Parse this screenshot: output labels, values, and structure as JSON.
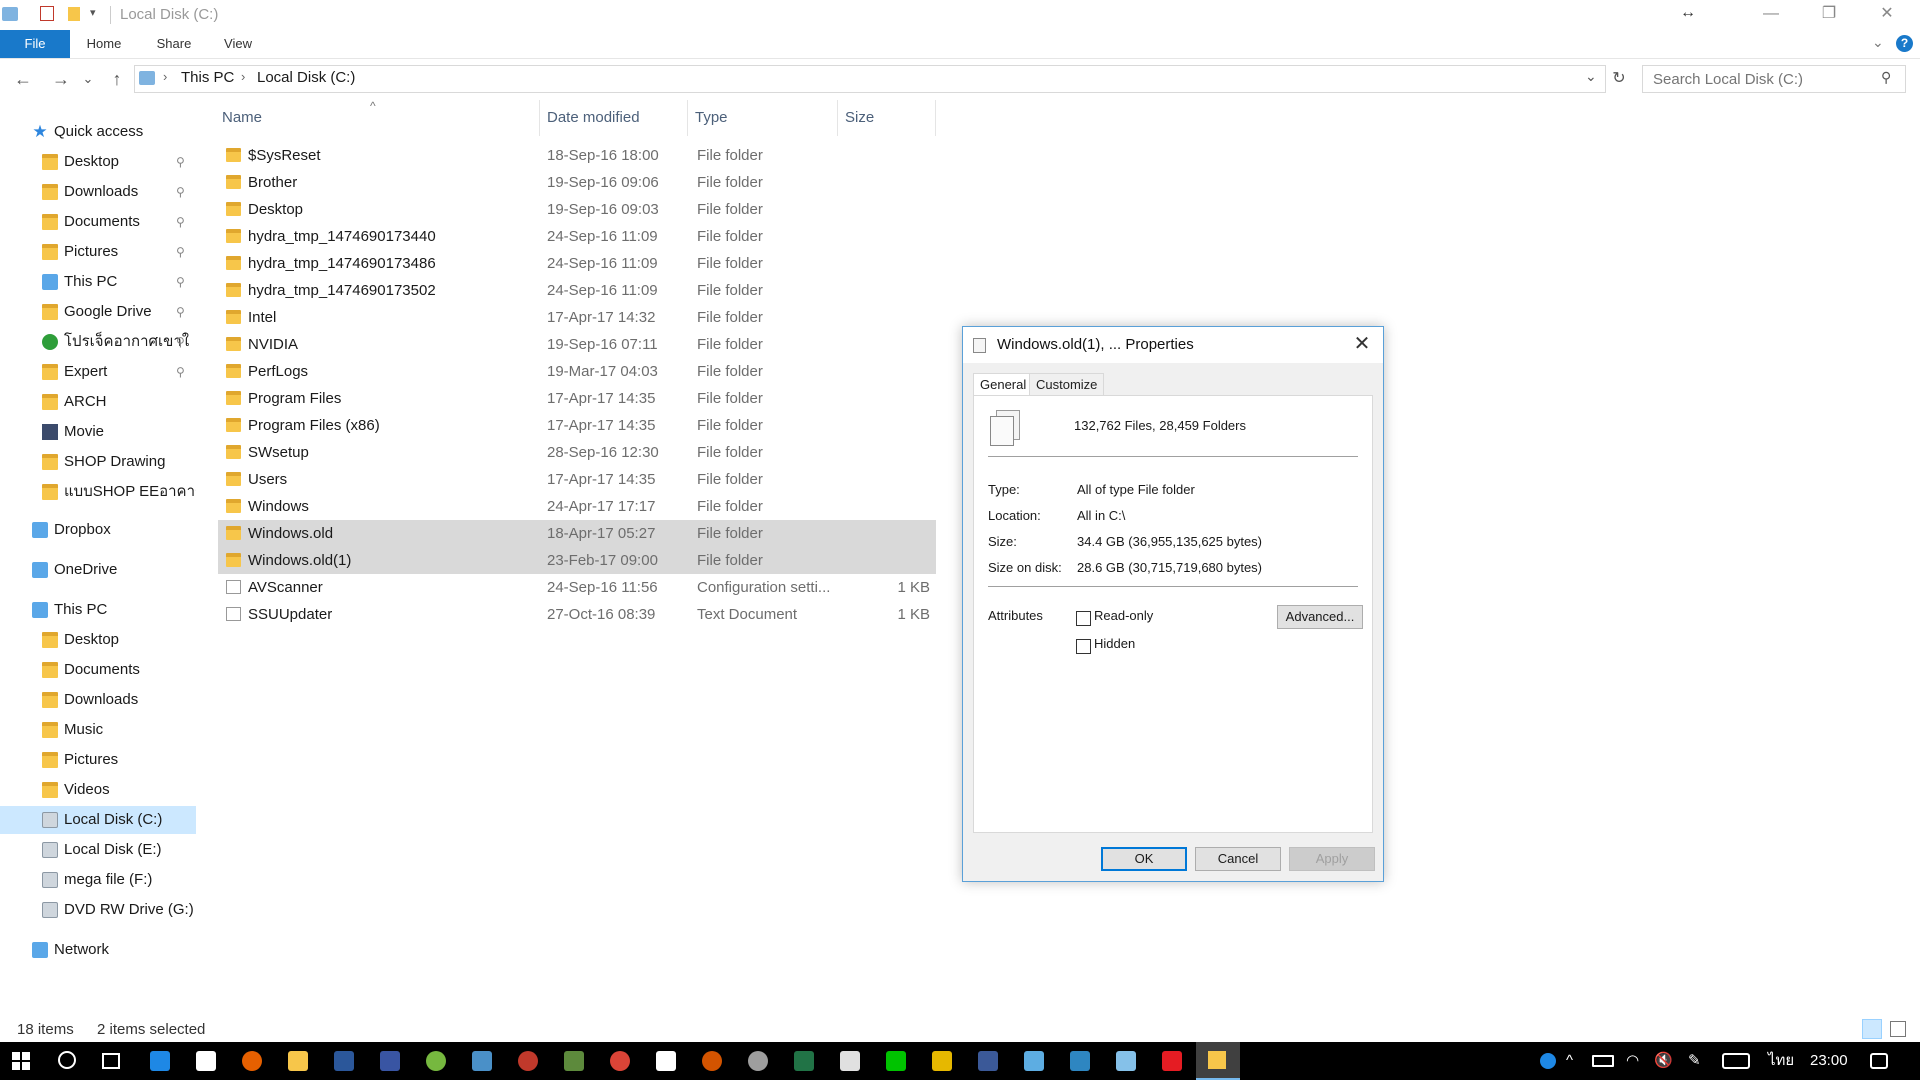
{
  "window": {
    "title": "Local Disk (C:)",
    "minimize": "—",
    "maximize": "❐",
    "close": "✕"
  },
  "ribbon": {
    "tabs": [
      "File",
      "Home",
      "Share",
      "View"
    ]
  },
  "nav": {
    "back": "←",
    "forward": "→",
    "recent": "⌄",
    "up": "↑",
    "refresh": "↻"
  },
  "address": {
    "segments": [
      "This PC",
      "Local Disk (C:)"
    ]
  },
  "search": {
    "placeholder": "Search Local Disk (C:)"
  },
  "sidebar": {
    "items": [
      {
        "label": "Quick access",
        "icon": "star-icon",
        "indent": 1,
        "pinned": false
      },
      {
        "label": "Desktop",
        "icon": "folder-icon",
        "indent": 2,
        "pinned": true
      },
      {
        "label": "Downloads",
        "icon": "folder-icon",
        "indent": 2,
        "pinned": true
      },
      {
        "label": "Documents",
        "icon": "folder-icon",
        "indent": 2,
        "pinned": true
      },
      {
        "label": "Pictures",
        "icon": "folder-icon",
        "indent": 2,
        "pinned": true
      },
      {
        "label": "This PC",
        "icon": "computer-icon",
        "indent": 2,
        "pinned": true
      },
      {
        "label": "Google Drive",
        "icon": "folder-icon",
        "indent": 2,
        "pinned": true
      },
      {
        "label": "โปรเจ็คอากาศเขาใ",
        "icon": "tree-icon",
        "indent": 2,
        "pinned": true
      },
      {
        "label": "Expert",
        "icon": "folder-icon",
        "indent": 2,
        "pinned": true
      },
      {
        "label": "ARCH",
        "icon": "folder-icon",
        "indent": 2,
        "pinned": false
      },
      {
        "label": "Movie",
        "icon": "film-icon",
        "indent": 2,
        "pinned": false
      },
      {
        "label": "SHOP Drawing",
        "icon": "folder-icon",
        "indent": 2,
        "pinned": false
      },
      {
        "label": "แบบSHOP EEอาคาร E",
        "icon": "folder-icon",
        "indent": 2,
        "pinned": false
      },
      {
        "label": "Dropbox",
        "icon": "dropbox-icon",
        "indent": 1,
        "pinned": false
      },
      {
        "label": "OneDrive",
        "icon": "cloud-icon",
        "indent": 1,
        "pinned": false
      },
      {
        "label": "This PC",
        "icon": "computer-icon",
        "indent": 1,
        "pinned": false
      },
      {
        "label": "Desktop",
        "icon": "folder-icon",
        "indent": 2,
        "pinned": false
      },
      {
        "label": "Documents",
        "icon": "folder-icon",
        "indent": 2,
        "pinned": false
      },
      {
        "label": "Downloads",
        "icon": "folder-icon",
        "indent": 2,
        "pinned": false
      },
      {
        "label": "Music",
        "icon": "folder-icon",
        "indent": 2,
        "pinned": false
      },
      {
        "label": "Pictures",
        "icon": "folder-icon",
        "indent": 2,
        "pinned": false
      },
      {
        "label": "Videos",
        "icon": "folder-icon",
        "indent": 2,
        "pinned": false
      },
      {
        "label": "Local Disk (C:)",
        "icon": "drive-icon",
        "indent": 2,
        "pinned": false,
        "selected": true
      },
      {
        "label": "Local Disk (E:)",
        "icon": "drive-icon",
        "indent": 2,
        "pinned": false
      },
      {
        "label": "mega file (F:)",
        "icon": "drive-icon",
        "indent": 2,
        "pinned": false
      },
      {
        "label": "DVD RW Drive (G:) ",
        "icon": "dvd-icon",
        "indent": 2,
        "pinned": false
      },
      {
        "label": "Network",
        "icon": "network-icon",
        "indent": 1,
        "pinned": false
      }
    ],
    "pin_glyph": "📌"
  },
  "filelist": {
    "columns": [
      "Name",
      "Date modified",
      "Type",
      "Size"
    ],
    "sort_glyph": "^",
    "rows": [
      {
        "name": "$SysReset",
        "date": "18-Sep-16 18:00",
        "type": "File folder",
        "size": "",
        "icon": "folder-icon"
      },
      {
        "name": "Brother",
        "date": "19-Sep-16 09:06",
        "type": "File folder",
        "size": "",
        "icon": "folder-icon"
      },
      {
        "name": "Desktop",
        "date": "19-Sep-16 09:03",
        "type": "File folder",
        "size": "",
        "icon": "folder-icon"
      },
      {
        "name": "hydra_tmp_1474690173440",
        "date": "24-Sep-16 11:09",
        "type": "File folder",
        "size": "",
        "icon": "folder-icon"
      },
      {
        "name": "hydra_tmp_1474690173486",
        "date": "24-Sep-16 11:09",
        "type": "File folder",
        "size": "",
        "icon": "folder-icon"
      },
      {
        "name": "hydra_tmp_1474690173502",
        "date": "24-Sep-16 11:09",
        "type": "File folder",
        "size": "",
        "icon": "folder-icon"
      },
      {
        "name": "Intel",
        "date": "17-Apr-17 14:32",
        "type": "File folder",
        "size": "",
        "icon": "folder-icon"
      },
      {
        "name": "NVIDIA",
        "date": "19-Sep-16 07:11",
        "type": "File folder",
        "size": "",
        "icon": "folder-icon"
      },
      {
        "name": "PerfLogs",
        "date": "19-Mar-17 04:03",
        "type": "File folder",
        "size": "",
        "icon": "folder-icon"
      },
      {
        "name": "Program Files",
        "date": "17-Apr-17 14:35",
        "type": "File folder",
        "size": "",
        "icon": "folder-icon"
      },
      {
        "name": "Program Files (x86)",
        "date": "17-Apr-17 14:35",
        "type": "File folder",
        "size": "",
        "icon": "folder-icon"
      },
      {
        "name": "SWsetup",
        "date": "28-Sep-16 12:30",
        "type": "File folder",
        "size": "",
        "icon": "folder-icon"
      },
      {
        "name": "Users",
        "date": "17-Apr-17 14:35",
        "type": "File folder",
        "size": "",
        "icon": "folder-icon"
      },
      {
        "name": "Windows",
        "date": "24-Apr-17 17:17",
        "type": "File folder",
        "size": "",
        "icon": "folder-icon"
      },
      {
        "name": "Windows.old",
        "date": "18-Apr-17 05:27",
        "type": "File folder",
        "size": "",
        "icon": "folder-icon",
        "selected": true
      },
      {
        "name": "Windows.old(1)",
        "date": "23-Feb-17 09:00",
        "type": "File folder",
        "size": "",
        "icon": "folder-icon",
        "selected": true
      },
      {
        "name": "AVScanner",
        "date": "24-Sep-16 11:56",
        "type": "Configuration setti...",
        "size": "1 KB",
        "icon": "settings-file-icon"
      },
      {
        "name": "SSUUpdater",
        "date": "27-Oct-16 08:39",
        "type": "Text Document",
        "size": "1 KB",
        "icon": "text-file-icon"
      }
    ]
  },
  "status": {
    "items": "18 items",
    "selected": "2 items selected"
  },
  "dialog": {
    "title": "Windows.old(1), ... Properties",
    "tabs": [
      "General",
      "Customize"
    ],
    "summary": "132,762 Files, 28,459 Folders",
    "fields": [
      {
        "label": "Type:",
        "value": "All of type File folder"
      },
      {
        "label": "Location:",
        "value": "All in C:\\"
      },
      {
        "label": "Size:",
        "value": "34.4 GB (36,955,135,625 bytes)"
      },
      {
        "label": "Size on disk:",
        "value": "28.6 GB (30,715,719,680 bytes)"
      }
    ],
    "attributes_label": "Attributes",
    "readonly_label": "Read-only",
    "hidden_label": "Hidden",
    "readonly_checked": false,
    "hidden_checked": false,
    "advanced_label": "Advanced...",
    "ok_label": "OK",
    "cancel_label": "Cancel",
    "apply_label": "Apply"
  },
  "taskbar": {
    "language": "ไทย",
    "clock": "23:00"
  },
  "colors": {
    "accent": "#1979ca",
    "selection": "#d9d9d9",
    "nav_selection": "#cce8ff",
    "folder": "#f7c64a"
  }
}
